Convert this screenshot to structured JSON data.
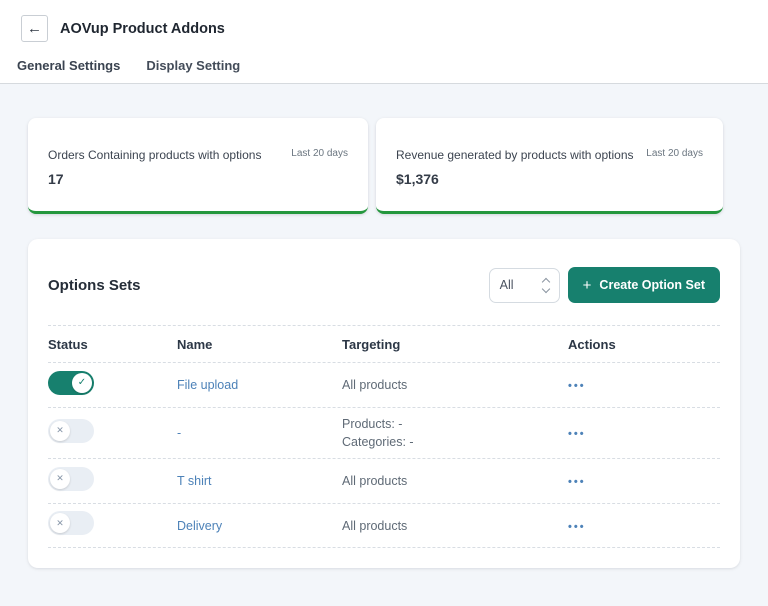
{
  "header": {
    "title": "AOVup Product Addons"
  },
  "tabs": [
    {
      "label": "General Settings"
    },
    {
      "label": "Display Setting"
    }
  ],
  "stat_cards": [
    {
      "label": "Orders Containing products with options",
      "period": "Last 20 days",
      "value": "17"
    },
    {
      "label": "Revenue generated by products with options",
      "period": "Last 20 days",
      "value": "$1,376"
    }
  ],
  "options_sets": {
    "title": "Options Sets",
    "filter": {
      "value": "All"
    },
    "create_button": {
      "label": "Create Option Set"
    },
    "columns": {
      "status": "Status",
      "name": "Name",
      "targeting": "Targeting",
      "actions": "Actions"
    },
    "rows": [
      {
        "status": "on",
        "name": "File upload",
        "targeting_line1": "All products",
        "targeting_line2": ""
      },
      {
        "status": "off",
        "name": "-",
        "targeting_line1": "Products: -",
        "targeting_line2": "Categories: -"
      },
      {
        "status": "off",
        "name": "T shirt",
        "targeting_line1": "All products",
        "targeting_line2": ""
      },
      {
        "status": "off",
        "name": "Delivery",
        "targeting_line1": "All products",
        "targeting_line2": ""
      }
    ]
  },
  "icons": {
    "back": "←",
    "plus": "+",
    "check": "✓",
    "cross": "✕",
    "ellipsis": "•••"
  },
  "colors": {
    "accent_teal": "#17806e",
    "stat_underline_green": "#24973d",
    "link_blue": "#4d82b8",
    "page_background": "#f3f6fa",
    "toggle_off_track": "#e9eef4"
  }
}
